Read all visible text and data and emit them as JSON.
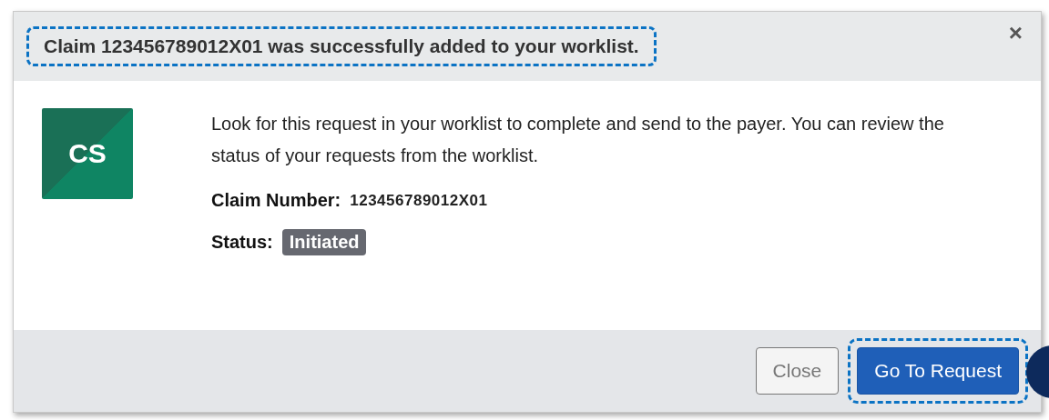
{
  "dialog": {
    "title": "Claim 123456789012X01 was successfully added to your worklist.",
    "close_icon": "×",
    "avatar": "CS",
    "message": "Look for this request in your worklist to complete and send to the payer. You can review the status of your requests from the worklist.",
    "fields": [
      {
        "kind": "text",
        "label": "Claim Number:",
        "value": "123456789012X01"
      },
      {
        "kind": "badge",
        "label": "Status:",
        "value": "Initiated"
      }
    ],
    "buttons": [
      {
        "kind": "secondary",
        "label": "Close"
      },
      {
        "kind": "primary",
        "label": "Go To Request"
      }
    ]
  }
}
